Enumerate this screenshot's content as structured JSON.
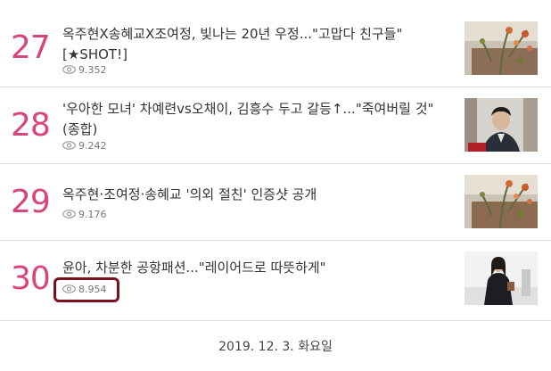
{
  "items": [
    {
      "rank": "27",
      "title": "옥주현X송혜교X조여정, 빛나는 20년 우정...\"고맙다 친구들\" [★SHOT!]",
      "views": "9.352",
      "thumb": "plant-on-table-photo"
    },
    {
      "rank": "28",
      "title": "'우아한 모녀' 차예련vs오채이, 김흥수 두고 갈등↑...\"죽여버릴 것\"(종합)",
      "views": "9.242",
      "thumb": "man-in-suit-photo"
    },
    {
      "rank": "29",
      "title": "옥주현·조여정·송혜교 '의외 절친' 인증샷 공개",
      "views": "9.176",
      "thumb": "plant-on-table-photo"
    },
    {
      "rank": "30",
      "title": "윤아, 차분한 공항패션...\"레이어드로 따뜻하게\"",
      "views": "8.954",
      "thumb": "woman-airport-photo"
    }
  ],
  "date": "2019. 12. 3. 화요일",
  "colors": {
    "rank": "#d8447c",
    "highlight": "#7a1020"
  }
}
